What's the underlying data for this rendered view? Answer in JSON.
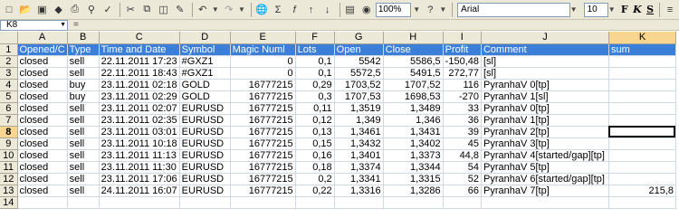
{
  "toolbar": {
    "zoom": "100%",
    "font_name": "Arial",
    "font_size": "10",
    "bold_label": "F",
    "italic_label": "K",
    "underline_label": "S"
  },
  "formula_bar": {
    "name_box": "K8",
    "fx": "="
  },
  "columns": [
    "A",
    "B",
    "C",
    "D",
    "E",
    "F",
    "G",
    "H",
    "I",
    "J",
    "K"
  ],
  "active_column": "K",
  "active_row": "8",
  "header": [
    "Opened/C",
    "Type",
    "Time and Date",
    "Symbol",
    "Magic Numl",
    "Lots",
    "Open",
    "Close",
    "Profit",
    "Comment",
    "sum"
  ],
  "rows": [
    [
      "2",
      "closed",
      "sell",
      "22.11.2011 17:23",
      "#GXZ1",
      "0",
      "0,1",
      "5542",
      "5586,5",
      "-150,48",
      "[sl]",
      ""
    ],
    [
      "3",
      "closed",
      "sell",
      "22.11.2011 18:43",
      "#GXZ1",
      "0",
      "0,1",
      "5572,5",
      "5491,5",
      "272,77",
      "[sl]",
      ""
    ],
    [
      "4",
      "closed",
      "buy",
      "23.11.2011 02:18",
      "GOLD",
      "16777215",
      "0,29",
      "1703,52",
      "1707,52",
      "116",
      "PyranhaV 0[tp]",
      ""
    ],
    [
      "5",
      "closed",
      "buy",
      "23.11.2011 02:29",
      "GOLD",
      "16777215",
      "0,3",
      "1707,53",
      "1698,53",
      "-270",
      "PyranhaV 1[sl]",
      ""
    ],
    [
      "6",
      "closed",
      "sell",
      "23.11.2011 02:07",
      "EURUSD",
      "16777215",
      "0,11",
      "1,3519",
      "1,3489",
      "33",
      "PyranhaV 0[tp]",
      ""
    ],
    [
      "7",
      "closed",
      "sell",
      "23.11.2011 02:35",
      "EURUSD",
      "16777215",
      "0,12",
      "1,349",
      "1,346",
      "36",
      "PyranhaV 1[tp]",
      ""
    ],
    [
      "8",
      "closed",
      "sell",
      "23.11.2011 03:01",
      "EURUSD",
      "16777215",
      "0,13",
      "1,3461",
      "1,3431",
      "39",
      "PyranhaV 2[tp]",
      ""
    ],
    [
      "9",
      "closed",
      "sell",
      "23.11.2011 10:18",
      "EURUSD",
      "16777215",
      "0,15",
      "1,3432",
      "1,3402",
      "45",
      "PyranhaV 3[tp]",
      ""
    ],
    [
      "10",
      "closed",
      "sell",
      "23.11.2011 11:13",
      "EURUSD",
      "16777215",
      "0,16",
      "1,3401",
      "1,3373",
      "44,8",
      "PyranhaV 4[started/gap][tp]",
      ""
    ],
    [
      "11",
      "closed",
      "sell",
      "23.11.2011 11:30",
      "EURUSD",
      "16777215",
      "0,18",
      "1,3374",
      "1,3344",
      "54",
      "PyranhaV 5[tp]",
      ""
    ],
    [
      "12",
      "closed",
      "sell",
      "23.11.2011 17:06",
      "EURUSD",
      "16777215",
      "0,2",
      "1,3341",
      "1,3315",
      "52",
      "PyranhaV 6[started/gap][tp]",
      ""
    ],
    [
      "13",
      "closed",
      "sell",
      "24.11.2011 16:07",
      "EURUSD",
      "16777215",
      "0,22",
      "1,3316",
      "1,3286",
      "66",
      "PyranhaV 7[tp]",
      "215,8"
    ],
    [
      "14",
      "",
      "",
      "",
      "",
      "",
      "",
      "",
      "",
      "",
      "",
      ""
    ]
  ]
}
